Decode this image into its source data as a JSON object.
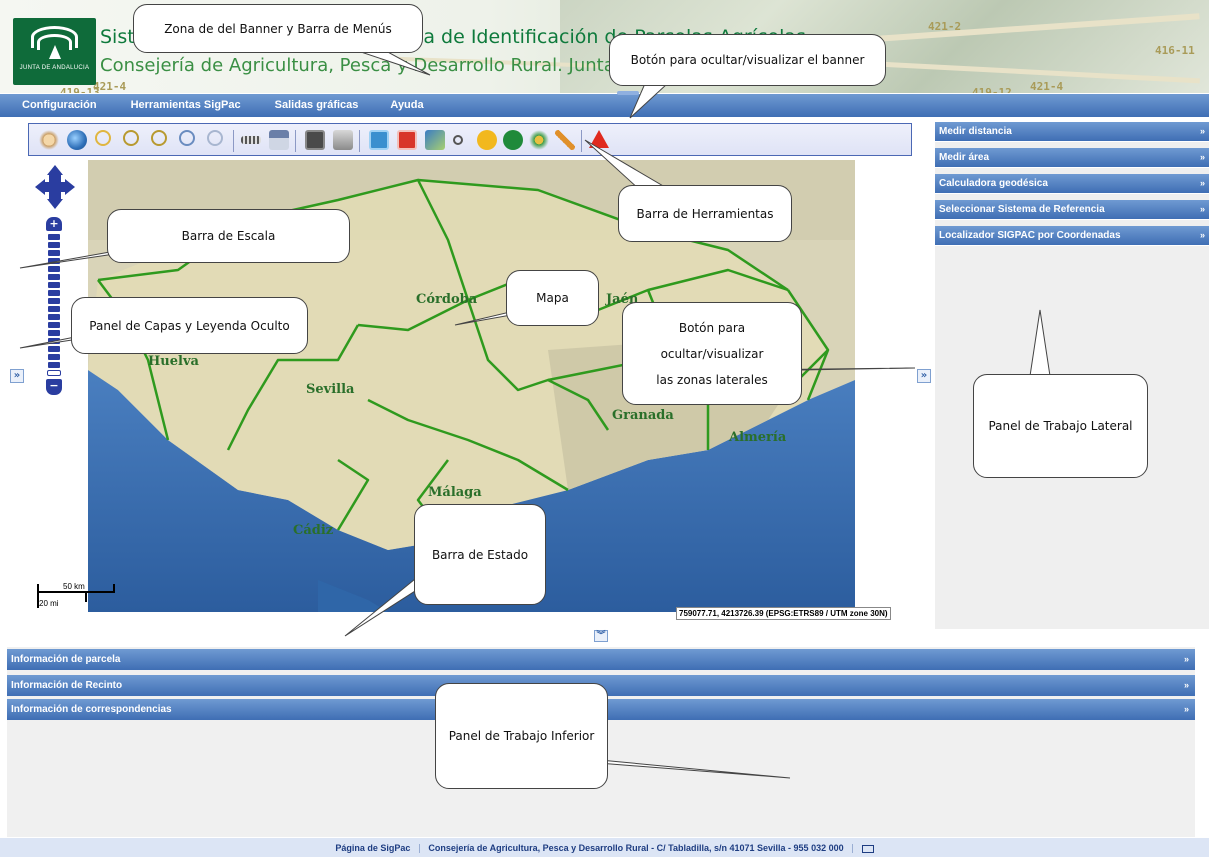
{
  "banner": {
    "title": "Sistema de Información Geográfica de Identificación de Parcelas Agrícolas",
    "subtitle": "Consejería de Agricultura, Pesca y Desarrollo Rural. Junta de Andalucía",
    "logo_text": "JUNTA DE ANDALUCIA",
    "parcel_labels": [
      "421-2",
      "416-11",
      "421-4",
      "421-4",
      "419-13",
      "419-12"
    ]
  },
  "menu": {
    "items": [
      "Configuración",
      "Herramientas SigPac",
      "Salidas gráficas",
      "Ayuda"
    ]
  },
  "toolbar": {
    "tools": [
      "pan-hand-icon",
      "globe-icon",
      "zoom-box-icon",
      "zoom-in-icon",
      "zoom-out-icon",
      "zoom-previous-icon",
      "zoom-next-icon",
      "measure-distance-icon",
      "measure-area-icon",
      "calculator-icon",
      "print-icon",
      "export-image-icon",
      "pdf-icon",
      "map-sheet-icon",
      "point-info-icon",
      "info-yellow-icon",
      "info-green-icon",
      "arrows-icon",
      "edit-pencil-icon",
      "warning-icon"
    ]
  },
  "map": {
    "provinces": [
      "Córdoba",
      "Jaén",
      "Huelva",
      "Sevilla",
      "Granada",
      "Almería",
      "Málaga",
      "Cádiz"
    ],
    "scale": {
      "km": "50 km",
      "mi": "20 mi"
    },
    "coords": "759077.71, 4213726.39 (EPSG:ETRS89 / UTM zone 30N)"
  },
  "right_panel": {
    "items": [
      "Medir distancia",
      "Medir área",
      "Calculadora geodésica",
      "Seleccionar Sistema de Referencia",
      "Localizador SIGPAC por Coordenadas"
    ],
    "chevron": "»"
  },
  "bottom_panel": {
    "items": [
      "Información de parcela",
      "Información de Recinto",
      "Información de correspondencias"
    ],
    "chevron": "»"
  },
  "toggles": {
    "left": "»",
    "right": "»",
    "bottom": "»"
  },
  "footer": {
    "link": "Página de SigPac",
    "address": "Consejería de Agricultura, Pesca y Desarrollo Rural - C/ Tabladilla, s/n 41071 Sevilla - 955 032 000"
  },
  "callouts": {
    "banner_menu": "Zona de del Banner y Barra de Menús",
    "banner_toggle": "Botón para ocultar/visualizar el banner",
    "toolbar": "Barra de Herramientas",
    "scale_bar": "Barra de Escala",
    "layers_panel": "Panel de Capas y Leyenda Oculto",
    "map": "Mapa",
    "side_toggle_1": "Botón para",
    "side_toggle_2": "ocultar/visualizar",
    "side_toggle_3": "las zonas laterales",
    "right_panel": "Panel de Trabajo Lateral",
    "status_bar": "Barra de Estado",
    "bottom_panel": "Panel de Trabajo Inferior"
  },
  "colors": {
    "menu_blue": "#3f6eb4",
    "banner_green": "#0e7a3c",
    "province_border": "#2f9a1e"
  }
}
